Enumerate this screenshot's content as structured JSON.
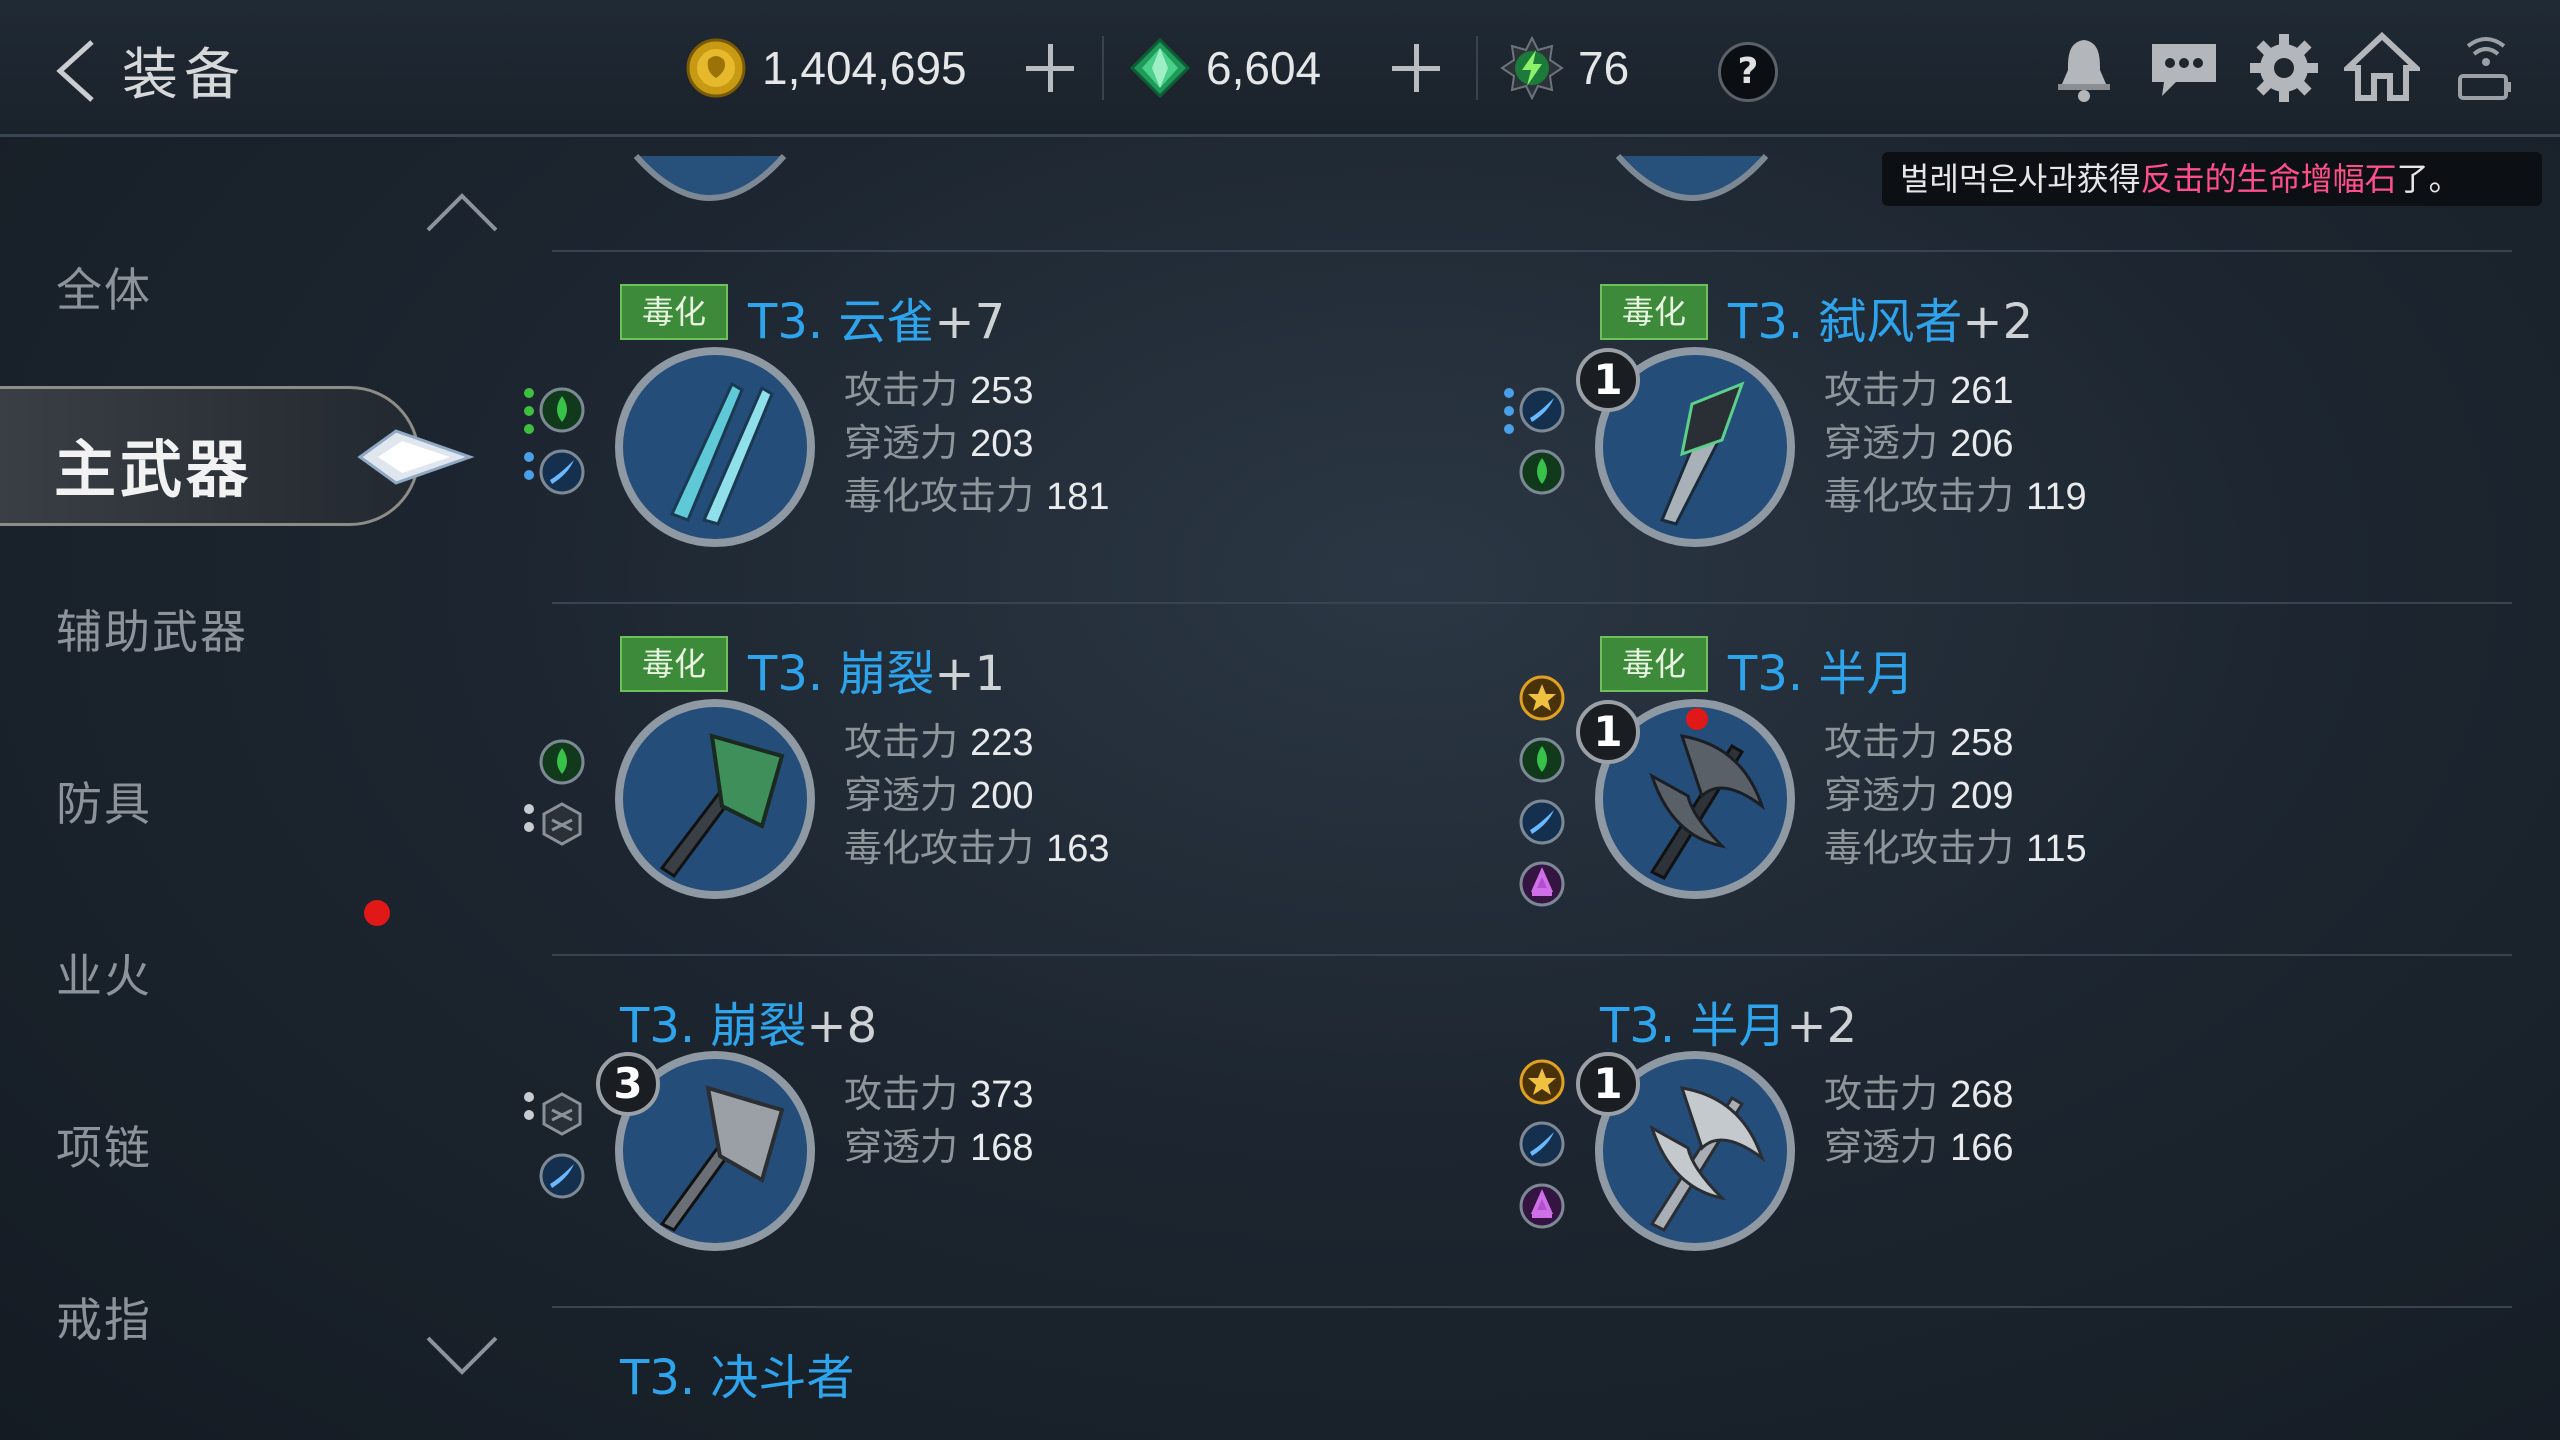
{
  "header": {
    "title": "装备",
    "gold": "1,404,695",
    "gems": "6,604",
    "energy": "76",
    "help_label": "?"
  },
  "notice": {
    "prefix": "벌레먹은사과获得",
    "highlight": "反击的生命增幅石",
    "suffix": "了。"
  },
  "sidebar": {
    "items": [
      "全体",
      "主武器",
      "辅助武器",
      "防具",
      "业火",
      "项链",
      "戒指"
    ],
    "active": "主武器"
  },
  "items": [
    {
      "tag": "毒化",
      "tier": "T3.",
      "name": "云雀",
      "plus": "+7",
      "level": "",
      "stats": [
        {
          "label": "攻击力",
          "value": "253"
        },
        {
          "label": "穿透力",
          "value": "203"
        },
        {
          "label": "毒化攻击力",
          "value": "181"
        }
      ]
    },
    {
      "tag": "毒化",
      "tier": "T3.",
      "name": "弑风者",
      "plus": "+2",
      "level": "1",
      "stats": [
        {
          "label": "攻击力",
          "value": "261"
        },
        {
          "label": "穿透力",
          "value": "206"
        },
        {
          "label": "毒化攻击力",
          "value": "119"
        }
      ]
    },
    {
      "tag": "毒化",
      "tier": "T3.",
      "name": "崩裂",
      "plus": "+1",
      "level": "",
      "stats": [
        {
          "label": "攻击力",
          "value": "223"
        },
        {
          "label": "穿透力",
          "value": "200"
        },
        {
          "label": "毒化攻击力",
          "value": "163"
        }
      ]
    },
    {
      "tag": "毒化",
      "tier": "T3.",
      "name": "半月",
      "plus": "",
      "level": "1",
      "stats": [
        {
          "label": "攻击力",
          "value": "258"
        },
        {
          "label": "穿透力",
          "value": "209"
        },
        {
          "label": "毒化攻击力",
          "value": "115"
        }
      ]
    },
    {
      "tag": "",
      "tier": "T3.",
      "name": "崩裂",
      "plus": "+8",
      "level": "3",
      "stats": [
        {
          "label": "攻击力",
          "value": "373"
        },
        {
          "label": "穿透力",
          "value": "168"
        }
      ]
    },
    {
      "tag": "",
      "tier": "T3.",
      "name": "半月",
      "plus": "+2",
      "level": "1",
      "stats": [
        {
          "label": "攻击力",
          "value": "268"
        },
        {
          "label": "穿透力",
          "value": "166"
        }
      ]
    },
    {
      "tag": "",
      "tier": "T3.",
      "name": "决斗者",
      "plus": "",
      "level": "",
      "stats": []
    }
  ]
}
